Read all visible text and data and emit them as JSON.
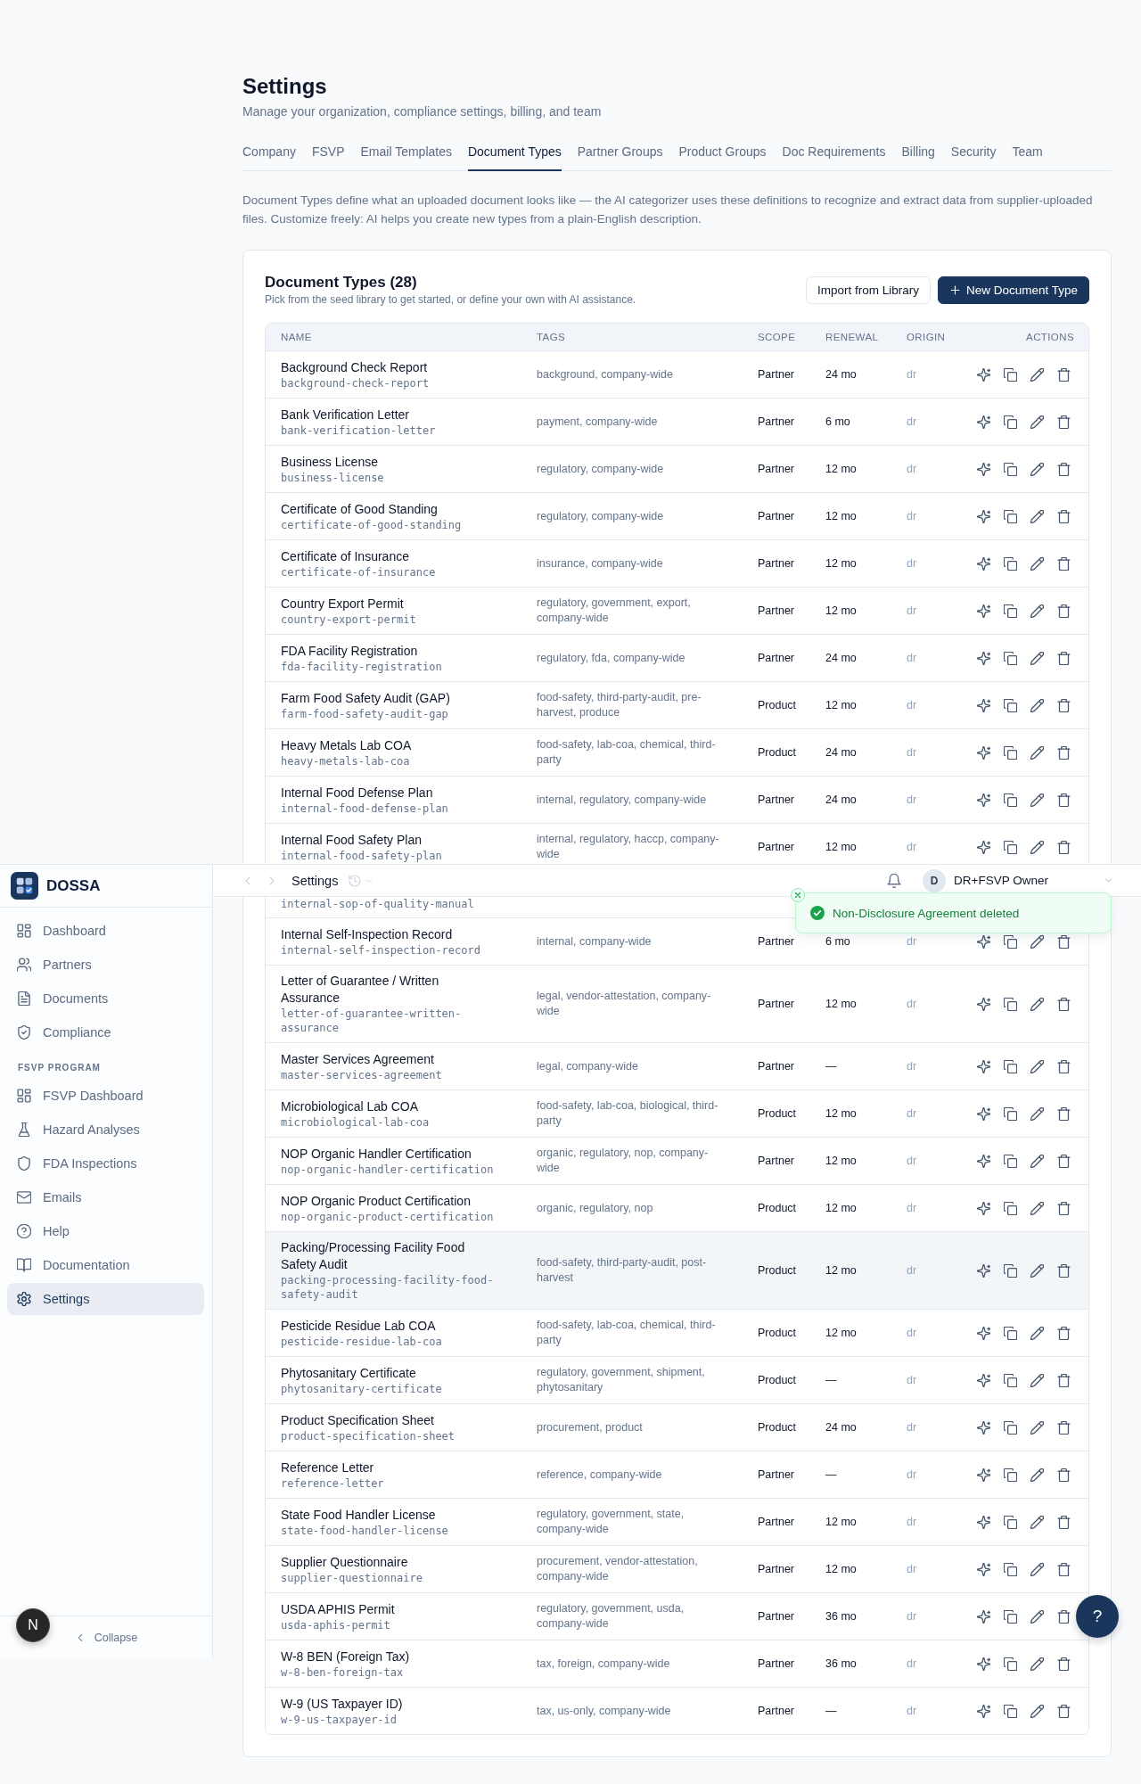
{
  "page": {
    "title": "Settings",
    "subtitle": "Manage your organization, compliance settings, billing, and team"
  },
  "tabs": [
    {
      "label": "Company",
      "selected": false
    },
    {
      "label": "FSVP",
      "selected": false
    },
    {
      "label": "Email Templates",
      "selected": false
    },
    {
      "label": "Document Types",
      "selected": true
    },
    {
      "label": "Partner Groups",
      "selected": false
    },
    {
      "label": "Product Groups",
      "selected": false
    },
    {
      "label": "Doc Requirements",
      "selected": false
    },
    {
      "label": "Billing",
      "selected": false
    },
    {
      "label": "Security",
      "selected": false
    },
    {
      "label": "Team",
      "selected": false
    }
  ],
  "description": "Document Types define what an uploaded document looks like — the AI categorizer uses these definitions to recognize and extract data from supplier-uploaded files. Customize freely: AI helps you create new types from a plain-English description.",
  "document_types": {
    "title": "Document Types (28)",
    "subtitle": "Pick from the seed library to get started, or define your own with AI assistance.",
    "buttons": [
      {
        "label": "Import from Library",
        "kind": "secondary"
      },
      {
        "label": "New Document Type",
        "kind": "primary"
      }
    ],
    "table": {
      "columns": [
        "NAME",
        "TAGS",
        "SCOPE",
        "RENEWAL",
        "ORIGIN",
        "ACTIONS"
      ],
      "rows": [
        {
          "name": "Background Check Report",
          "slug": "background-check-report",
          "tags": "background, company-wide",
          "scope": "Partner",
          "renewal": "24 mo",
          "origin": "dr",
          "hovered": false
        },
        {
          "name": "Bank Verification Letter",
          "slug": "bank-verification-letter",
          "tags": "payment, company-wide",
          "scope": "Partner",
          "renewal": "6 mo",
          "origin": "dr",
          "hovered": false
        },
        {
          "name": "Business License",
          "slug": "business-license",
          "tags": "regulatory, company-wide",
          "scope": "Partner",
          "renewal": "12 mo",
          "origin": "dr",
          "hovered": false
        },
        {
          "name": "Certificate of Good Standing",
          "slug": "certificate-of-good-standing",
          "tags": "regulatory, company-wide",
          "scope": "Partner",
          "renewal": "12 mo",
          "origin": "dr",
          "hovered": false
        },
        {
          "name": "Certificate of Insurance",
          "slug": "certificate-of-insurance",
          "tags": "insurance, company-wide",
          "scope": "Partner",
          "renewal": "12 mo",
          "origin": "dr",
          "hovered": false
        },
        {
          "name": "Country Export Permit",
          "slug": "country-export-permit",
          "tags": "regulatory, government, export, company-wide",
          "scope": "Partner",
          "renewal": "12 mo",
          "origin": "dr",
          "hovered": false
        },
        {
          "name": "FDA Facility Registration",
          "slug": "fda-facility-registration",
          "tags": "regulatory, fda, company-wide",
          "scope": "Partner",
          "renewal": "24 mo",
          "origin": "dr",
          "hovered": false
        },
        {
          "name": "Farm Food Safety Audit (GAP)",
          "slug": "farm-food-safety-audit-gap",
          "tags": "food-safety, third-party-audit, pre-harvest, produce",
          "scope": "Product",
          "renewal": "12 mo",
          "origin": "dr",
          "hovered": false
        },
        {
          "name": "Heavy Metals Lab COA",
          "slug": "heavy-metals-lab-coa",
          "tags": "food-safety, lab-coa, chemical, third-party",
          "scope": "Product",
          "renewal": "24 mo",
          "origin": "dr",
          "hovered": false
        },
        {
          "name": "Internal Food Defense Plan",
          "slug": "internal-food-defense-plan",
          "tags": "internal, regulatory, company-wide",
          "scope": "Partner",
          "renewal": "24 mo",
          "origin": "dr",
          "hovered": false
        },
        {
          "name": "Internal Food Safety Plan",
          "slug": "internal-food-safety-plan",
          "tags": "internal, regulatory, haccp, company-wide",
          "scope": "Partner",
          "renewal": "12 mo",
          "origin": "dr",
          "hovered": false
        },
        {
          "slug": "internal-sop-of-quality-manual",
          "hovered": false
        },
        {
          "name": "Internal Self-Inspection Record",
          "slug": "internal-self-inspection-record",
          "tags": "internal, company-wide",
          "scope": "Partner",
          "renewal": "6 mo",
          "origin": "dr",
          "hovered": false
        },
        {
          "name": "Letter of Guarantee / Written Assurance",
          "slug": "letter-of-guarantee-written-assurance",
          "tags": "legal, vendor-attestation, company-wide",
          "scope": "Partner",
          "renewal": "12 mo",
          "origin": "dr",
          "hovered": false
        },
        {
          "name": "Master Services Agreement",
          "slug": "master-services-agreement",
          "tags": "legal, company-wide",
          "scope": "Partner",
          "renewal": "—",
          "origin": "dr",
          "hovered": false
        },
        {
          "name": "Microbiological Lab COA",
          "slug": "microbiological-lab-coa",
          "tags": "food-safety, lab-coa, biological, third-party",
          "scope": "Product",
          "renewal": "12 mo",
          "origin": "dr",
          "hovered": false
        },
        {
          "name": "NOP Organic Handler Certification",
          "slug": "nop-organic-handler-certification",
          "tags": "organic, regulatory, nop, company-wide",
          "scope": "Partner",
          "renewal": "12 mo",
          "origin": "dr",
          "hovered": false
        },
        {
          "name": "NOP Organic Product Certification",
          "slug": "nop-organic-product-certification",
          "tags": "organic, regulatory, nop",
          "scope": "Product",
          "renewal": "12 mo",
          "origin": "dr",
          "hovered": false
        },
        {
          "name": "Packing/Processing Facility Food Safety Audit",
          "slug": "packing-processing-facility-food-safety-audit",
          "tags": "food-safety, third-party-audit, post-harvest",
          "scope": "Product",
          "renewal": "12 mo",
          "origin": "dr",
          "hovered": true
        },
        {
          "name": "Pesticide Residue Lab COA",
          "slug": "pesticide-residue-lab-coa",
          "tags": "food-safety, lab-coa, chemical, third-party",
          "scope": "Product",
          "renewal": "12 mo",
          "origin": "dr",
          "hovered": false
        },
        {
          "name": "Phytosanitary Certificate",
          "slug": "phytosanitary-certificate",
          "tags": "regulatory, government, shipment, phytosanitary",
          "scope": "Product",
          "renewal": "—",
          "origin": "dr",
          "hovered": false
        },
        {
          "name": "Product Specification Sheet",
          "slug": "product-specification-sheet",
          "tags": "procurement, product",
          "scope": "Product",
          "renewal": "24 mo",
          "origin": "dr",
          "hovered": false
        },
        {
          "name": "Reference Letter",
          "slug": "reference-letter",
          "tags": "reference, company-wide",
          "scope": "Partner",
          "renewal": "—",
          "origin": "dr",
          "hovered": false
        },
        {
          "name": "State Food Handler License",
          "slug": "state-food-handler-license",
          "tags": "regulatory, government, state, company-wide",
          "scope": "Partner",
          "renewal": "12 mo",
          "origin": "dr",
          "hovered": false
        },
        {
          "name": "Supplier Questionnaire",
          "slug": "supplier-questionnaire",
          "tags": "procurement, vendor-attestation, company-wide",
          "scope": "Partner",
          "renewal": "12 mo",
          "origin": "dr",
          "hovered": false
        },
        {
          "name": "USDA APHIS Permit",
          "slug": "usda-aphis-permit",
          "tags": "regulatory, government, usda, company-wide",
          "scope": "Partner",
          "renewal": "36 mo",
          "origin": "dr",
          "hovered": false
        },
        {
          "name": "W-8 BEN (Foreign Tax)",
          "slug": "w-8-ben-foreign-tax",
          "tags": "tax, foreign, company-wide",
          "scope": "Partner",
          "renewal": "36 mo",
          "origin": "dr",
          "hovered": false
        },
        {
          "name": "W-9 (US Taxpayer ID)",
          "slug": "w-9-us-taxpayer-id",
          "tags": "tax, us-only, company-wide",
          "scope": "Partner",
          "renewal": "—",
          "origin": "dr",
          "hovered": false
        }
      ]
    }
  },
  "sidebar": {
    "brand": "DOSSA",
    "sections": [
      {
        "items": [
          {
            "label": "Dashboard",
            "selected": false
          },
          {
            "label": "Partners",
            "selected": false
          },
          {
            "label": "Documents",
            "selected": false
          },
          {
            "label": "Compliance",
            "selected": false
          }
        ]
      },
      {
        "heading": "FSVP PROGRAM",
        "items": [
          {
            "label": "FSVP Dashboard",
            "selected": false
          },
          {
            "label": "Hazard Analyses",
            "selected": false
          },
          {
            "label": "FDA Inspections",
            "selected": false
          },
          {
            "label": "Emails",
            "selected": false
          },
          {
            "label": "Help",
            "selected": false
          },
          {
            "label": "Documentation",
            "selected": false
          },
          {
            "label": "Settings",
            "selected": true
          }
        ]
      }
    ],
    "collapse": "Collapse"
  },
  "topbar": {
    "title": "Settings",
    "user": {
      "initial": "D",
      "name": "DR+FSVP Owner"
    }
  },
  "toast": {
    "kind": "success",
    "message": "Non-Disclosure Agreement deleted"
  },
  "help_button": {
    "label": "?"
  },
  "dev_badge": {
    "label": "N"
  }
}
